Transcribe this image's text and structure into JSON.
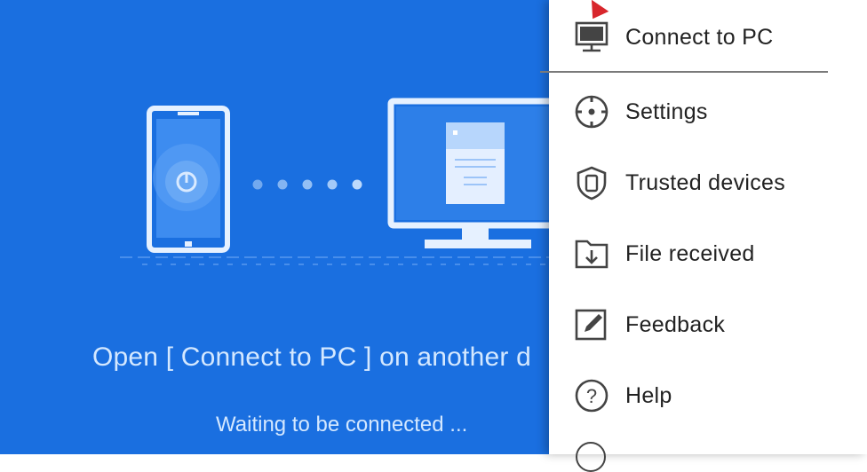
{
  "main": {
    "instruction": "Open [ Connect to PC ] on another d",
    "waiting": "Waiting to be connected ..."
  },
  "menu": {
    "items": [
      {
        "label": "Connect to PC",
        "icon": "monitor-icon"
      },
      {
        "label": "Settings",
        "icon": "settings-icon"
      },
      {
        "label": "Trusted devices",
        "icon": "shield-icon"
      },
      {
        "label": "File received",
        "icon": "folder-download-icon"
      },
      {
        "label": "Feedback",
        "icon": "feedback-icon"
      },
      {
        "label": "Help",
        "icon": "help-icon"
      }
    ]
  },
  "colors": {
    "background_blue": "#1a6fe0",
    "accent_red": "#d8262c",
    "menu_text": "#222222"
  }
}
